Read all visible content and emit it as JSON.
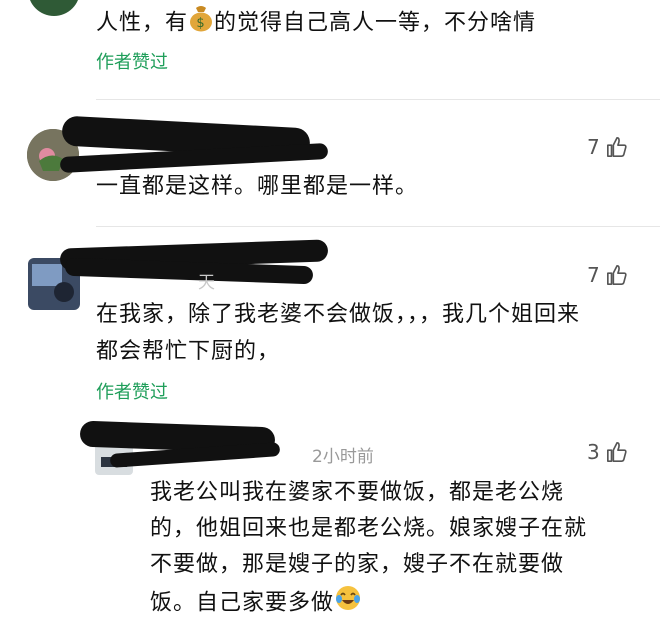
{
  "comments": [
    {
      "text_before": "人性，有",
      "text_after": "的觉得自己高人一等，不分啥情",
      "icon": "money-bag-icon",
      "author_liked": "作者赞过"
    },
    {
      "text": "一直都是这样。哪里都是一样。",
      "likes": "7"
    },
    {
      "text_line1": "在我家，除了我老婆不会做饭，，，我几个姐回来",
      "text_line2": "都会帮忙下厨的，",
      "likes": "7",
      "author_liked": "作者赞过"
    },
    {
      "meta_time": "2小时前",
      "likes": "3",
      "text_line1": "我老公叫我在婆家不要做饭，都是老公烧",
      "text_line2": "的，他姐回来也是都老公烧。娘家嫂子在就",
      "text_line3": "不要做，那是嫂子的家，嫂子不在就要做",
      "text_line4": "饭。自己家要多做",
      "emoji": "crying-laughing-emoji"
    }
  ],
  "colors": {
    "accent_green": "#1f9e5a",
    "scribble": "#111111",
    "divider": "#e6e6e6"
  }
}
